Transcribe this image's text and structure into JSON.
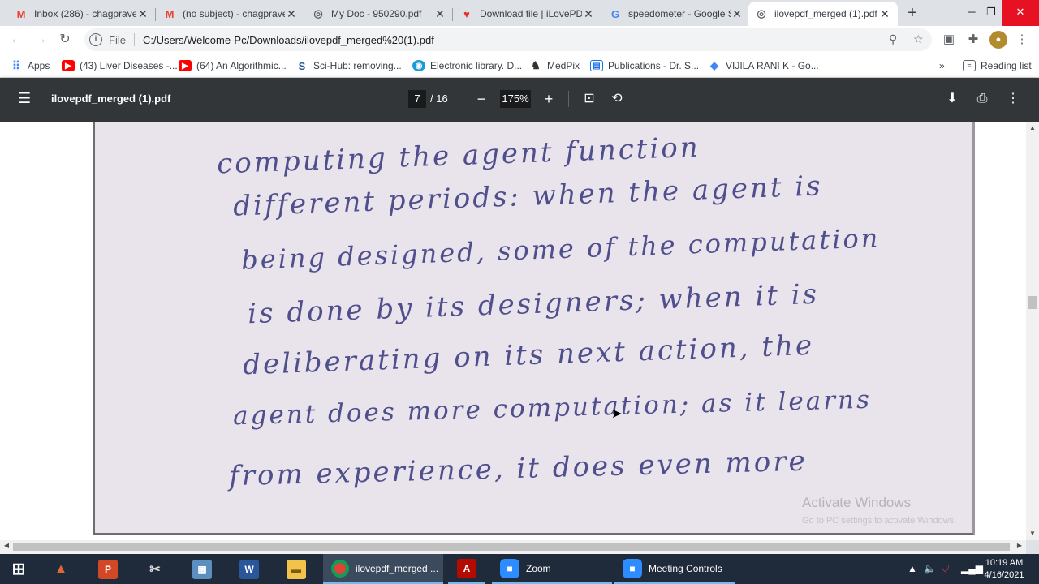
{
  "browser": {
    "tabs": [
      {
        "title": "Inbox (286) - chagprave",
        "icon": "gmail-icon",
        "active": false
      },
      {
        "title": "(no subject) - chagprave",
        "icon": "gmail-icon",
        "active": false
      },
      {
        "title": "My Doc - 950290.pdf",
        "icon": "globe-icon",
        "active": false
      },
      {
        "title": "Download file | iLovePDF",
        "icon": "ilovepdf-heart-icon",
        "active": false
      },
      {
        "title": "speedometer - Google S",
        "icon": "google-icon",
        "active": false
      },
      {
        "title": "ilovepdf_merged (1).pdf",
        "icon": "globe-icon",
        "active": true
      }
    ],
    "address": {
      "scheme": "File",
      "url": "C:/Users/Welcome-Pc/Downloads/ilovepdf_merged%20(1).pdf"
    },
    "bookmarks": [
      {
        "label": "Apps",
        "icon": "apps-grid-icon"
      },
      {
        "label": "(43) Liver Diseases -...",
        "icon": "youtube-icon"
      },
      {
        "label": "(64) An Algorithmic...",
        "icon": "youtube-icon"
      },
      {
        "label": "Sci-Hub: removing...",
        "icon": "scihub-icon"
      },
      {
        "label": "Electronic library. D...",
        "icon": "globe-icon"
      },
      {
        "label": "MedPix",
        "icon": "medpix-icon"
      },
      {
        "label": "Publications - Dr. S...",
        "icon": "page-icon"
      },
      {
        "label": "VIJILA RANI K - Go...",
        "icon": "scholar-icon"
      }
    ],
    "reading_list": "Reading list",
    "colors": {
      "accent": "#1a73e8",
      "gmail": "#ea4335",
      "youtube": "#ff0000"
    }
  },
  "pdf": {
    "filename": "ilovepdf_merged (1).pdf",
    "current_page": "7",
    "total_pages": "/ 16",
    "zoom": "175%",
    "handwritten_lines": [
      "computing the agent function",
      "different periods: when the agent is",
      "being designed, some of the computation",
      "is done by its designers; when it is",
      "deliberating on its next action, the",
      "agent does more computation; as it learns",
      "from experience, it does even more"
    ]
  },
  "watermark": {
    "line1": "Activate Windows",
    "line2": "Go to PC settings to activate Windows."
  },
  "taskbar": {
    "items": [
      {
        "label": "",
        "icon": "windows-start-icon"
      },
      {
        "label": "",
        "icon": "matlab-icon"
      },
      {
        "label": "",
        "icon": "powerpoint-icon"
      },
      {
        "label": "",
        "icon": "snipping-tool-icon"
      },
      {
        "label": "",
        "icon": "calculator-icon"
      },
      {
        "label": "",
        "icon": "word-icon"
      },
      {
        "label": "",
        "icon": "file-explorer-icon"
      },
      {
        "label": "ilovepdf_merged ...",
        "icon": "chrome-icon"
      },
      {
        "label": "",
        "icon": "acrobat-icon"
      },
      {
        "label": "Zoom",
        "icon": "zoom-icon"
      },
      {
        "label": "Meeting Controls",
        "icon": "zoom-icon"
      }
    ],
    "time": "10:19 AM",
    "date": "4/16/2021"
  }
}
